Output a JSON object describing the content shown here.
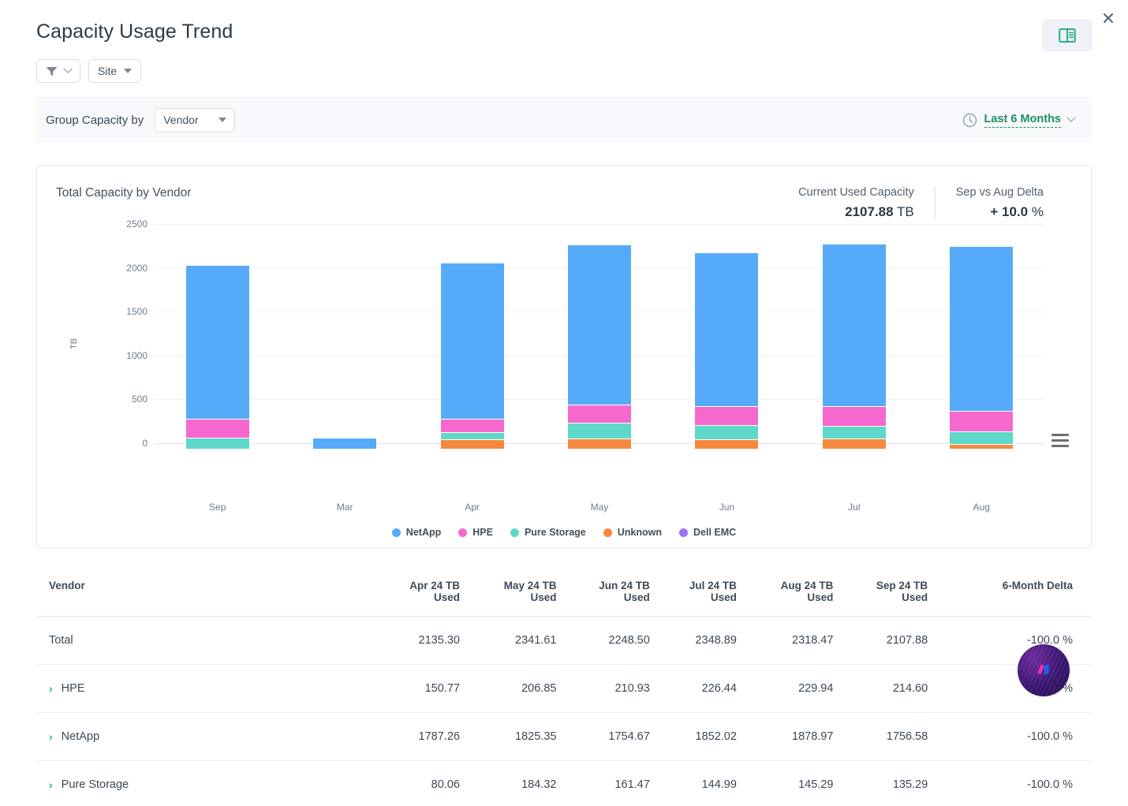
{
  "header": {
    "title": "Capacity Usage Trend",
    "close_label": "×",
    "report_icon": "book-report-icon"
  },
  "filters": {
    "filter_icon": "funnel-icon",
    "filter_chevron_icon": "chevron-down-icon",
    "site_label": "Site",
    "site_caret_icon": "caret-down-icon"
  },
  "group_bar": {
    "label": "Group Capacity by",
    "selected": "Vendor",
    "caret_icon": "caret-down-icon",
    "clock_icon": "clock-icon",
    "time_range": "Last 6 Months",
    "time_chevron_icon": "chevron-down-icon"
  },
  "chart_card": {
    "title": "Total Capacity by Vendor",
    "kpis": [
      {
        "label": "Current Used Capacity",
        "value": "2107.88",
        "unit": "TB"
      },
      {
        "label": "Sep vs Aug Delta",
        "value": "+ 10.0",
        "unit": "%"
      }
    ],
    "menu_icon": "hamburger-menu-icon"
  },
  "chart_data": {
    "type": "bar",
    "stacked": true,
    "title": "Total Capacity by Vendor",
    "xlabel": "",
    "ylabel": "TB",
    "ylim": [
      0,
      2500
    ],
    "yticks": [
      0,
      500,
      1000,
      1500,
      2000,
      2500
    ],
    "grid": true,
    "legend_position": "bottom",
    "categories": [
      "Sep",
      "Mar",
      "Apr",
      "May",
      "Jun",
      "Jul",
      "Aug"
    ],
    "series": [
      {
        "name": "NetApp",
        "color": "#55aaf9",
        "values": [
          1756.58,
          135.0,
          1787.26,
          1825.35,
          1754.67,
          1852.02,
          1878.97
        ]
      },
      {
        "name": "HPE",
        "color": "#f668cd",
        "values": [
          214.6,
          0,
          150.77,
          206.85,
          210.93,
          226.44,
          229.94
        ]
      },
      {
        "name": "Pure Storage",
        "color": "#5ed8c8",
        "values": [
          135.29,
          0,
          80.06,
          184.32,
          161.47,
          144.99,
          145.29
        ]
      },
      {
        "name": "Unknown",
        "color": "#f7893f",
        "values": [
          0,
          0,
          117.21,
          125.09,
          121.43,
          125.44,
          64.27
        ]
      },
      {
        "name": "Dell EMC",
        "color": "#a172f0",
        "values": [
          0,
          0,
          0,
          0,
          0,
          0,
          0
        ]
      }
    ]
  },
  "table": {
    "columns": [
      "Vendor",
      "Apr 24 TB Used",
      "May 24 TB Used",
      "Jun 24 TB Used",
      "Jul 24 TB Used",
      "Aug 24 TB Used",
      "Sep 24 TB Used",
      "6-Month Delta"
    ],
    "column_lines": [
      [
        "Vendor",
        ""
      ],
      [
        "Apr 24 TB",
        "Used"
      ],
      [
        "May 24 TB",
        "Used"
      ],
      [
        "Jun 24 TB",
        "Used"
      ],
      [
        "Jul 24 TB",
        "Used"
      ],
      [
        "Aug 24 TB",
        "Used"
      ],
      [
        "Sep 24 TB",
        "Used"
      ],
      [
        "6-Month Delta",
        ""
      ]
    ],
    "rows": [
      {
        "name": "Total",
        "expandable": false,
        "values": [
          "2135.30",
          "2341.61",
          "2248.50",
          "2348.89",
          "2318.47",
          "2107.88"
        ],
        "delta": "-100.0 %"
      },
      {
        "name": "HPE",
        "expandable": true,
        "expander_icon": "chevron-right-icon",
        "values": [
          "150.77",
          "206.85",
          "210.93",
          "226.44",
          "229.94",
          "214.60"
        ],
        "delta": "-100.0 %"
      },
      {
        "name": "NetApp",
        "expandable": true,
        "expander_icon": "chevron-right-icon",
        "values": [
          "1787.26",
          "1825.35",
          "1754.67",
          "1852.02",
          "1878.97",
          "1756.58"
        ],
        "delta": "-100.0 %"
      },
      {
        "name": "Pure Storage",
        "expandable": true,
        "expander_icon": "chevron-right-icon",
        "values": [
          "80.06",
          "184.32",
          "161.47",
          "144.99",
          "145.29",
          "135.29"
        ],
        "delta": "-100.0 %"
      }
    ]
  },
  "overlay": {
    "logo_icon": "brand-logo-badge"
  },
  "colors": {
    "accent_green": "#1f8f63",
    "expander_green": "#2bb07a",
    "netapp": "#55aaf9",
    "hpe": "#f668cd",
    "pure_storage": "#5ed8c8",
    "unknown": "#f7893f",
    "dell_emc": "#a172f0"
  }
}
